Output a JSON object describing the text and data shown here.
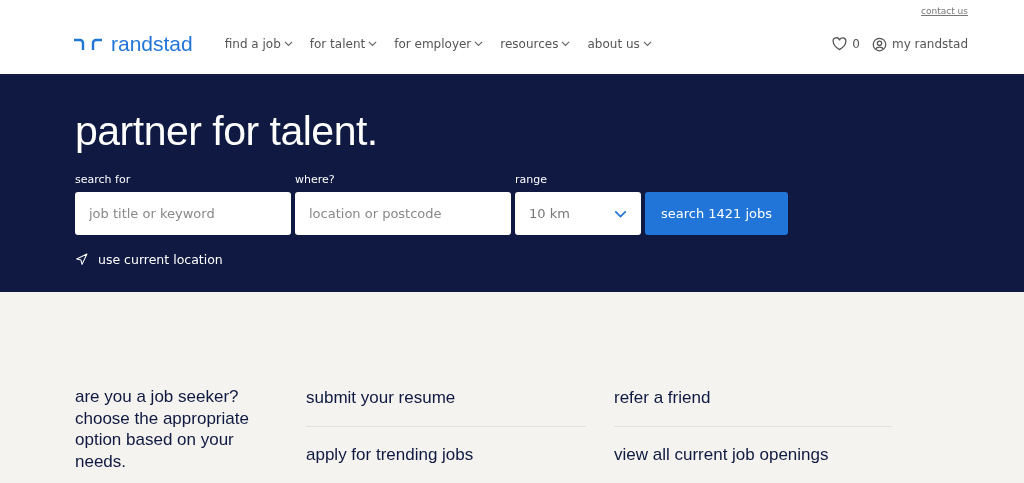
{
  "header": {
    "contact_link": "contact us",
    "logo": "randstad",
    "nav": [
      "find a job",
      "for talent",
      "for employer",
      "resources",
      "about us"
    ],
    "favorites_count": "0",
    "account_link": "my randstad"
  },
  "hero": {
    "title": "partner for talent.",
    "search_for": {
      "label": "search for",
      "placeholder": "job title or keyword"
    },
    "where": {
      "label": "where?",
      "placeholder": "location or postcode"
    },
    "range": {
      "label": "range",
      "value": "10 km"
    },
    "search_button": "search 1421 jobs",
    "location_link": "use current location"
  },
  "seeker": {
    "intro": "are you a job seeker? choose the appropriate option based on your needs.",
    "columns": [
      [
        "submit your resume",
        "apply for trending jobs"
      ],
      [
        "refer a friend",
        "view all current job openings"
      ]
    ]
  }
}
